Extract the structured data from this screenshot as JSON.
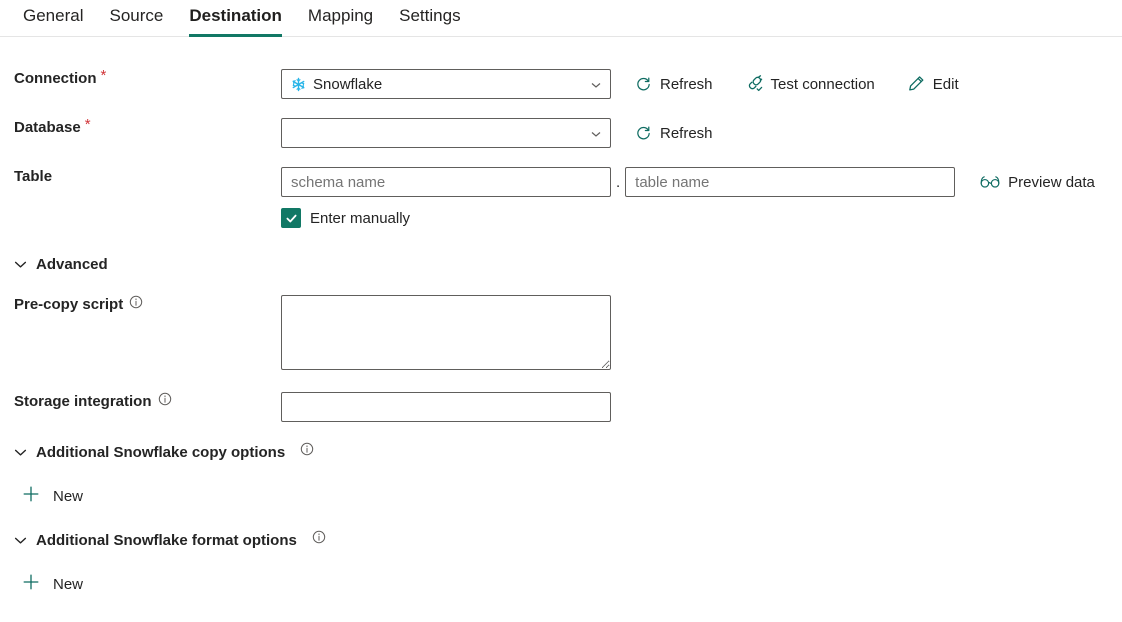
{
  "tabs": [
    {
      "label": "General",
      "active": false
    },
    {
      "label": "Source",
      "active": false
    },
    {
      "label": "Destination",
      "active": true
    },
    {
      "label": "Mapping",
      "active": false
    },
    {
      "label": "Settings",
      "active": false
    }
  ],
  "colors": {
    "accent": "#117865",
    "required_asterisk": "#d13438",
    "icon_teal": "#0f6c62",
    "snowflake_blue": "#29b5e8",
    "placeholder": "#8a8886",
    "border": "#605e5c"
  },
  "fields": {
    "connection": {
      "label": "Connection",
      "required": true,
      "value": "Snowflake",
      "icon": "snowflake-icon",
      "chevron": "chevron-down-icon",
      "actions": [
        {
          "label": "Refresh",
          "icon": "refresh-icon"
        },
        {
          "label": "Test connection",
          "icon": "plug-check-icon"
        },
        {
          "label": "Edit",
          "icon": "pencil-icon"
        }
      ]
    },
    "database": {
      "label": "Database",
      "required": true,
      "value": "",
      "chevron": "chevron-down-icon",
      "actions": [
        {
          "label": "Refresh",
          "icon": "refresh-icon"
        }
      ]
    },
    "table": {
      "label": "Table",
      "required": false,
      "schema_placeholder": "schema name",
      "schema_value": "",
      "separator": ".",
      "table_placeholder": "table name",
      "table_value": "",
      "preview": {
        "label": "Preview data",
        "icon": "glasses-icon"
      },
      "enter_manually": {
        "label": "Enter manually",
        "checked": true
      }
    },
    "pre_copy_script": {
      "label": "Pre-copy script",
      "info": "info-icon",
      "value": "",
      "placeholder": ""
    },
    "storage_integration": {
      "label": "Storage integration",
      "info": "info-icon",
      "value": "",
      "placeholder": ""
    }
  },
  "sections": {
    "advanced": {
      "label": "Advanced",
      "expanded": true,
      "caret": "chevron-down-icon"
    },
    "copy_options": {
      "label": "Additional Snowflake copy options",
      "expanded": true,
      "caret": "chevron-down-icon",
      "info": "info-icon",
      "new_label": "New",
      "new_icon": "plus-icon"
    },
    "format_options": {
      "label": "Additional Snowflake format options",
      "expanded": true,
      "caret": "chevron-down-icon",
      "info": "info-icon",
      "new_label": "New",
      "new_icon": "plus-icon"
    }
  }
}
